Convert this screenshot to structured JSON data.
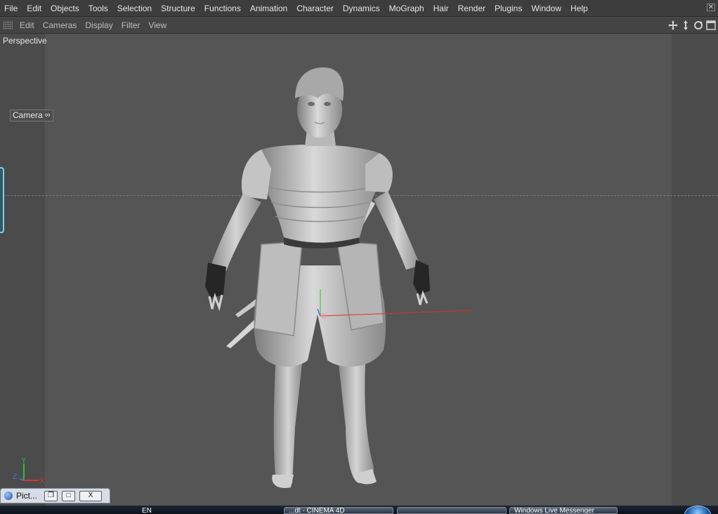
{
  "menubar": {
    "items": [
      "File",
      "Edit",
      "Objects",
      "Tools",
      "Selection",
      "Structure",
      "Functions",
      "Animation",
      "Character",
      "Dynamics",
      "MoGraph",
      "Hair",
      "Render",
      "Plugins",
      "Window",
      "Help"
    ]
  },
  "viewport_menu": {
    "items": [
      "Edit",
      "Cameras",
      "Display",
      "Filter",
      "View"
    ]
  },
  "viewport": {
    "label": "Perspective",
    "camera_tag": "Camera",
    "camera_tag_icon": "infinity-icon",
    "axes": {
      "x": "X",
      "y": "Y",
      "z": "Z"
    }
  },
  "floating_window": {
    "title": "Pict...",
    "icon": "cinema4d-sphere-icon"
  },
  "taskbar": {
    "language": "EN",
    "item1": "...dt · CINEMA 4D",
    "item3": "Windows Live Messenger"
  },
  "colors": {
    "viewport_bg": "#555555",
    "menubar_bg": "#3d3d3d",
    "x_axis": "#e03030",
    "y_axis": "#30c030",
    "z_axis": "#4070e0",
    "accent_tab": "#6fd6f0"
  }
}
